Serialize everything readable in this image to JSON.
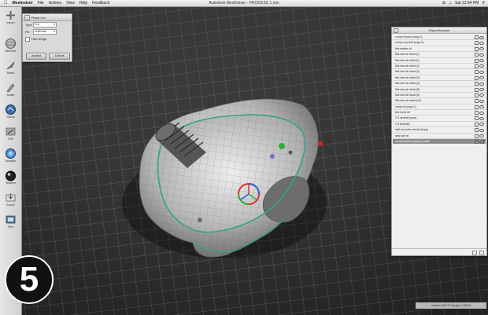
{
  "menubar": {
    "app_name": "Meshmixer",
    "items": [
      "File",
      "Actions",
      "View",
      "Help",
      "Feedback"
    ],
    "window_title": "Autodesk Meshmixer - PROCESS 1.mix",
    "clock": "Sat 12:54 PM"
  },
  "toolbar": {
    "items": [
      {
        "label": "Import",
        "icon": "plus-icon"
      },
      {
        "label": "Meshmix",
        "icon": "sphere-icon"
      },
      {
        "label": "Select",
        "icon": "arrow-icon"
      },
      {
        "label": "Sculpt",
        "icon": "brush-icon"
      },
      {
        "label": "Stamp",
        "icon": "stamp-icon"
      },
      {
        "label": "Edit",
        "icon": "edit-icon"
      },
      {
        "label": "Analysis",
        "icon": "analysis-icon"
      },
      {
        "label": "Shaders",
        "icon": "shader-ball-icon"
      },
      {
        "label": "Export",
        "icon": "export-icon"
      },
      {
        "label": "Print",
        "icon": "print-icon"
      }
    ]
  },
  "plane_cut": {
    "title": "Plane Cut",
    "type_label": "Type",
    "type_value": "Cut",
    "fill_label": "Fill",
    "fill_value": "UnitNoise",
    "hard_edge_label": "Hard Edge",
    "accept_label": "Accept",
    "cancel_label": "Cancel"
  },
  "object_browser": {
    "title": "Object Browser",
    "objects": [
      "comp nb joint (copy 1)",
      "comp nb joint2 (copy 2)",
      "flat replace id",
      "flat rove air ideal (1)",
      "flat rove air ideal (1)",
      "flat rove air ideal (1)",
      "flat rove air ideal (2)",
      "flat rove air ideal (3)",
      "flat rove air ideal (4)",
      "flat rove air ideal (5)",
      "flat rove air ideal (6)",
      "flat rove air ideal (10)",
      "comp nb (copy 1)",
      "line need ref",
      "2 ft neutral (copy)",
      "1 ft (rebuild)",
      "half root sole rebuild (copy)",
      "step sort at",
      "comp nb joint (copy 4) (edit)"
    ],
    "selected_index": 18
  },
  "step_number": "5",
  "status_text": "Vertices 89678 Triangles 180000",
  "colors": {
    "selection_green": "#2fa58a",
    "gizmo_red": "#e03030",
    "gizmo_blue": "#3060e0"
  }
}
